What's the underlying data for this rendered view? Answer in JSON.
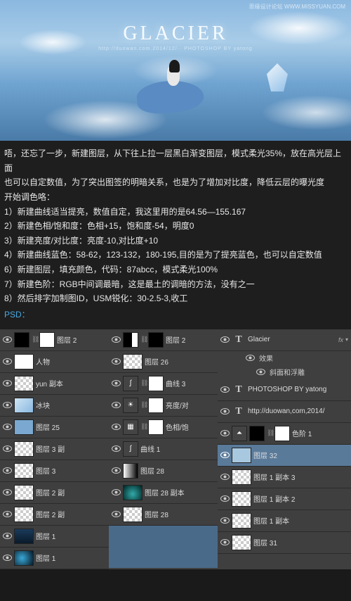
{
  "hero": {
    "watermark": "思缘设计论坛  WWW.MISSYUAN.COM",
    "title": "GLACIER",
    "subtitle": "http://duowan.com.2014/12/··  PHOTOSHOP BY yatong"
  },
  "instructions": {
    "intro1": "唔，还忘了一步，新建图层，从下往上拉一层黑白渐变图层，模式柔光35%，放在高光层上面",
    "intro2": "也可以自定数值，为了突出图签的明暗关系，也是为了增加对比度，降低云层的曝光度",
    "intro3": "开始调色咯：",
    "s1": "1）新建曲线适当提亮，数值自定，我这里用的是64.56—155.167",
    "s2": "2）新建色相/饱和度：色相+15，饱和度-54，明度0",
    "s3": "3）新建亮度/对比度：亮度-10,对比度+10",
    "s4": "4）新建曲线蓝色：58-62，123-132，180-195,目的是为了提亮蓝色，也可以自定数值",
    "s5": "6）新建图层，填充颜色，代码：87abcc，模式柔光100%",
    "s6": "7）新建色阶：RGB中间调最暗，这是最土的调暗的方法，没有之一",
    "s7": "8）然后排字加制图ID，USM锐化：30-2.5-3,收工",
    "psd": "PSD："
  },
  "c1": {
    "r0": "图层 2",
    "r1": "人物",
    "r2": "yun 副本",
    "r3": "冰块",
    "r4": "图层 25",
    "r5": "图层 3 副",
    "r6": "图层 3",
    "r7": "图层 2 副",
    "r8": "图层 2 副",
    "r9": "图层 1",
    "r10": "图层 1"
  },
  "c2": {
    "r0": "图层 2",
    "r1": "图层 26",
    "r2": "曲线 3",
    "r3": "亮度/对",
    "r4": "色相/饱",
    "r5": "曲线 1",
    "r6": "图层 28",
    "r7": "图层 28 副本",
    "r8": "图层 28"
  },
  "c3": {
    "r0": "Glacier",
    "fx": "fx",
    "eff": "效果",
    "bev": "斜面和浮雕",
    "r1": "PHOTOSHOP BY yatong",
    "r2": "http://duowan,com,2014/",
    "r3": "色阶 1",
    "r4": "图层 32",
    "r5": "图层 1 副本 3",
    "r6": "图层 1 副本 2",
    "r7": "图层 1 副本",
    "r8": "图层 31"
  }
}
